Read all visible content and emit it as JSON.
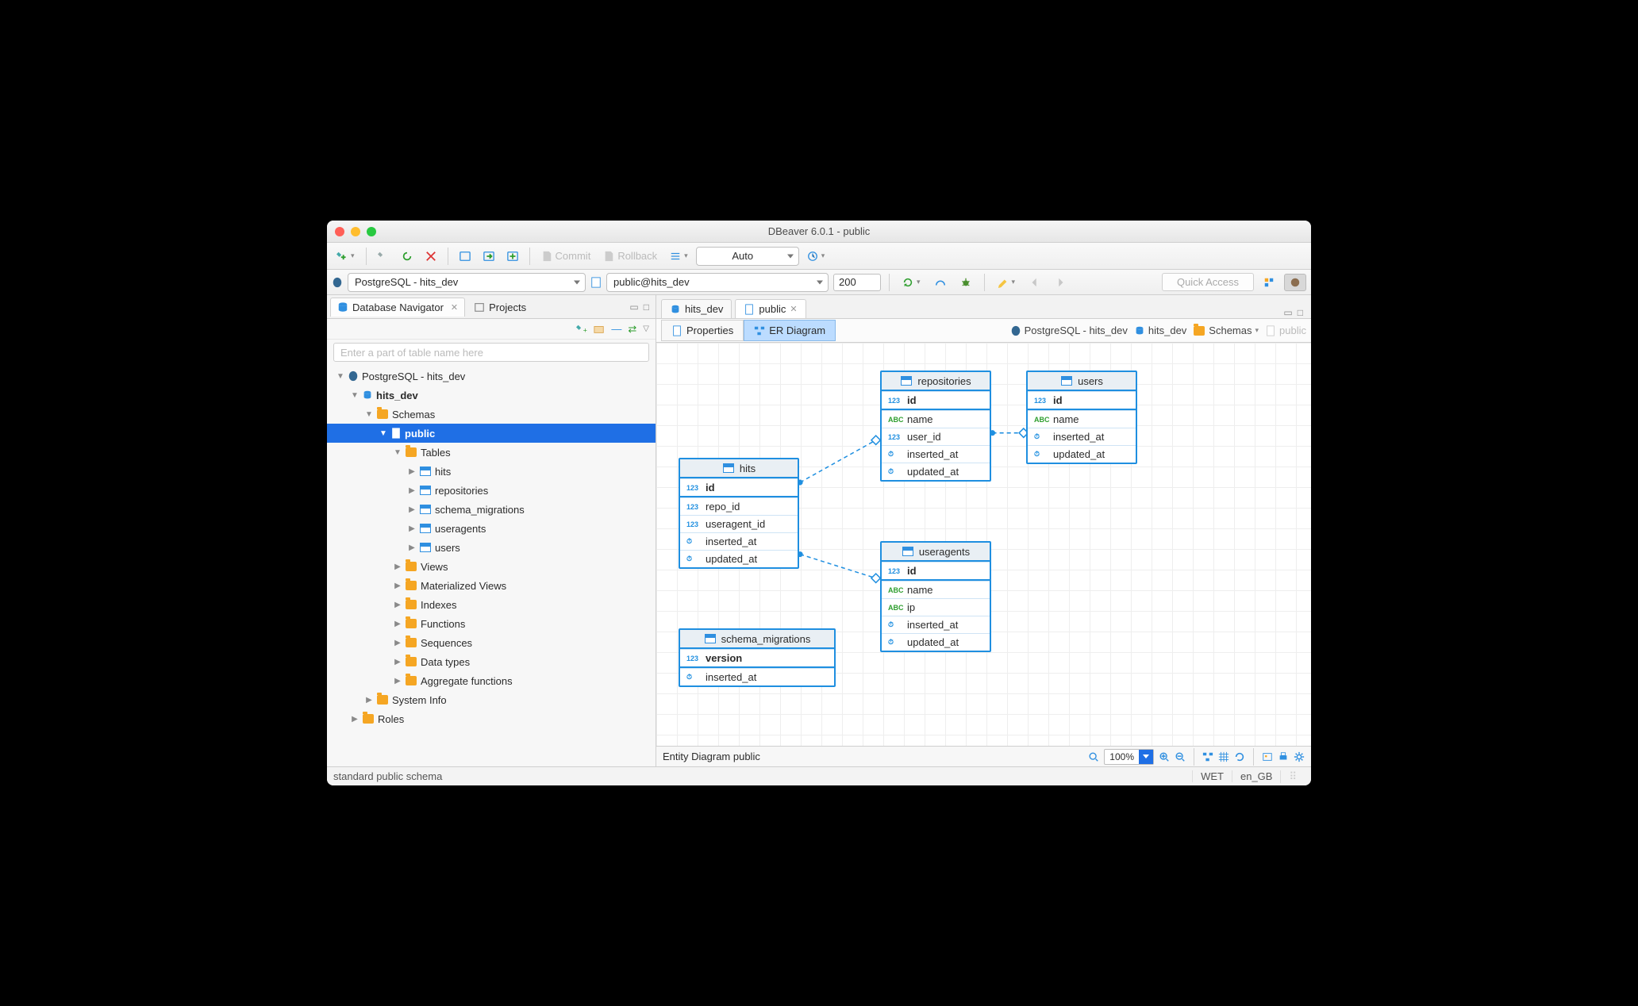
{
  "window": {
    "title": "DBeaver 6.0.1 - public"
  },
  "toolbar": {
    "commit": "Commit",
    "rollback": "Rollback",
    "txmode": "Auto",
    "quick_access": "Quick Access"
  },
  "row2": {
    "connection": "PostgreSQL - hits_dev",
    "schema": "public@hits_dev",
    "limit": "200"
  },
  "left": {
    "tab_navigator": "Database Navigator",
    "tab_projects": "Projects",
    "search_placeholder": "Enter a part of table name here",
    "tree": {
      "conn": "PostgreSQL - hits_dev",
      "db": "hits_dev",
      "schemas": "Schemas",
      "public": "public",
      "tables": "Tables",
      "t_hits": "hits",
      "t_repositories": "repositories",
      "t_schema_migrations": "schema_migrations",
      "t_useragents": "useragents",
      "t_users": "users",
      "views": "Views",
      "matviews": "Materialized Views",
      "indexes": "Indexes",
      "functions": "Functions",
      "sequences": "Sequences",
      "datatypes": "Data types",
      "aggfunc": "Aggregate functions",
      "sysinfo": "System Info",
      "roles": "Roles"
    }
  },
  "editor": {
    "tab_hitsdev": "hits_dev",
    "tab_public": "public",
    "subtab_properties": "Properties",
    "subtab_er": "ER Diagram",
    "bc_conn": "PostgreSQL - hits_dev",
    "bc_db": "hits_dev",
    "bc_schemas": "Schemas",
    "bc_public": "public"
  },
  "diagram": {
    "hits": {
      "name": "hits",
      "cols": [
        "id",
        "repo_id",
        "useragent_id",
        "inserted_at",
        "updated_at"
      ]
    },
    "repositories": {
      "name": "repositories",
      "cols": [
        "id",
        "name",
        "user_id",
        "inserted_at",
        "updated_at"
      ]
    },
    "users": {
      "name": "users",
      "cols": [
        "id",
        "name",
        "inserted_at",
        "updated_at"
      ]
    },
    "useragents": {
      "name": "useragents",
      "cols": [
        "id",
        "name",
        "ip",
        "inserted_at",
        "updated_at"
      ]
    },
    "schema_migrations": {
      "name": "schema_migrations",
      "cols": [
        "version",
        "inserted_at"
      ]
    }
  },
  "statusbar": {
    "caption": "Entity Diagram  public",
    "zoom": "100%"
  },
  "footer": {
    "desc": "standard public schema",
    "tz": "WET",
    "locale": "en_GB"
  }
}
